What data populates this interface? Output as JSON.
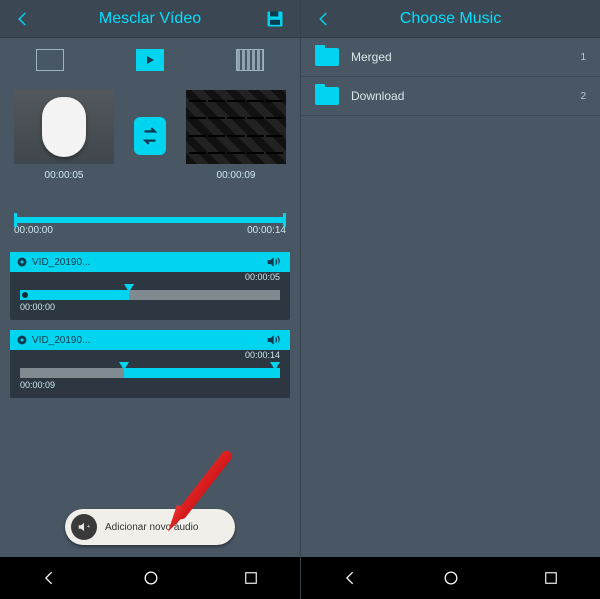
{
  "accent": "#00d4ee",
  "left": {
    "title": "Mesclar Vídeo",
    "thumbs": [
      {
        "duration": "00:00:05"
      },
      {
        "duration": "00:00:09"
      }
    ],
    "timeline": {
      "start": "00:00:00",
      "end": "00:00:14"
    },
    "audio": [
      {
        "name": "VID_20190...",
        "labelRight": "00:00:05",
        "labelBottom": "00:00:00",
        "fillPct": 42,
        "pinPct": 42
      },
      {
        "name": "VID_20190...",
        "labelRight": "00:00:14",
        "labelBottom": "00:00:09",
        "fillPct": 100,
        "cutPct": 40
      }
    ],
    "addAudioLabel": "Adicionar novo áudio"
  },
  "right": {
    "title": "Choose Music",
    "folders": [
      {
        "name": "Merged",
        "count": "1"
      },
      {
        "name": "Download",
        "count": "2"
      }
    ]
  }
}
